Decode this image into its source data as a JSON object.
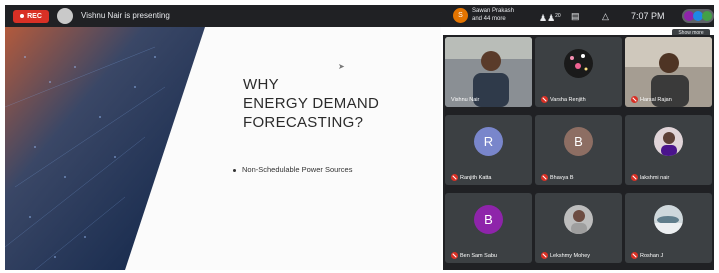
{
  "topbar": {
    "rec_label": "REC",
    "presenter_text": "Vishnu Nair is presenting",
    "notification_line1": "Sawan Prakash",
    "notification_line2": "and 44 more",
    "notification_initial": "S",
    "participants_badge": "20",
    "time": "7:07 PM",
    "tooltip": "Show more"
  },
  "slide": {
    "title_lines": [
      "WHY",
      "ENERGY DEMAND",
      "FORECASTING?"
    ],
    "bullet": "Non-Schedulable Power Sources"
  },
  "participants": [
    {
      "name": "Vishnu Nair",
      "kind": "video",
      "muted": false
    },
    {
      "name": "Varsha Renjith",
      "kind": "photo",
      "muted": true
    },
    {
      "name": "Harsal Rajan",
      "kind": "video",
      "muted": true
    },
    {
      "name": "Ranjith Katta",
      "kind": "letter",
      "initial": "R",
      "color": "#7986cb",
      "muted": true
    },
    {
      "name": "Bhavya B",
      "kind": "letter",
      "initial": "B",
      "color": "#8d6e63",
      "muted": true
    },
    {
      "name": "lakshmi nair",
      "kind": "photo",
      "muted": true
    },
    {
      "name": "Ben Sam Sabu",
      "kind": "letter",
      "initial": "B",
      "color": "#8e24aa",
      "muted": true
    },
    {
      "name": "Lekshmy Mohey",
      "kind": "photo",
      "muted": true
    },
    {
      "name": "Roshan J",
      "kind": "photo",
      "muted": true
    }
  ]
}
